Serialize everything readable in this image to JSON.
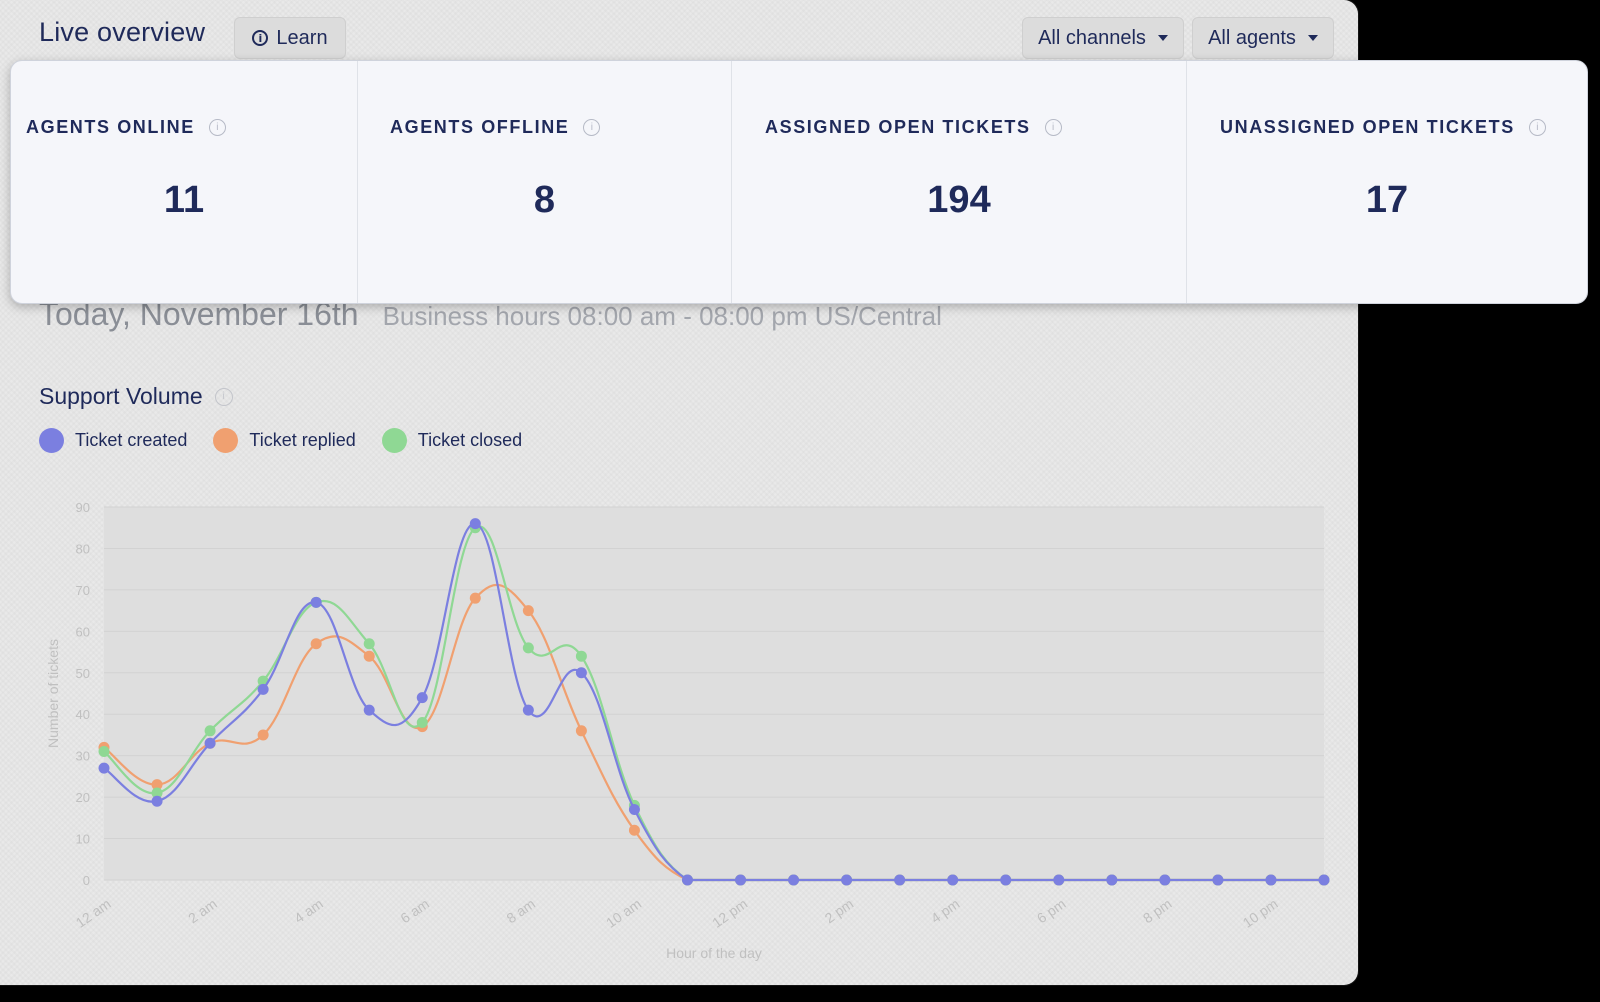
{
  "header": {
    "title": "Live overview",
    "learn_label": "Learn",
    "channels_label": "All channels",
    "agents_label": "All agents"
  },
  "stats": [
    {
      "label": "AGENTS ONLINE",
      "value": "11"
    },
    {
      "label": "AGENTS OFFLINE",
      "value": "8"
    },
    {
      "label": "ASSIGNED OPEN TICKETS",
      "value": "194"
    },
    {
      "label": "UNASSIGNED OPEN TICKETS",
      "value": "17"
    }
  ],
  "date_title": "Today, November 16th",
  "business_hours": "Business hours 08:00 am - 08:00 pm US/Central",
  "section_title": "Support Volume",
  "colors": {
    "created": "#7b7fe0",
    "replied": "#f0a070",
    "closed": "#8fd894",
    "primary_text": "#1f2a5a"
  },
  "chart_data": {
    "type": "line",
    "x": [
      "12 am",
      "1 am",
      "2 am",
      "3 am",
      "4 am",
      "5 am",
      "6 am",
      "7 am",
      "8 am",
      "9 am",
      "10 am",
      "11 am",
      "12 pm",
      "1 pm",
      "2 pm",
      "3 pm",
      "4 pm",
      "5 pm",
      "6 pm",
      "7 pm",
      "8 pm",
      "9 pm",
      "10 pm",
      "11 pm"
    ],
    "tick_labels": [
      "12 am",
      "2 am",
      "4 am",
      "6 am",
      "8 am",
      "10 am",
      "12 pm",
      "2 pm",
      "4 pm",
      "6 pm",
      "8 pm",
      "10 pm"
    ],
    "series": [
      {
        "name": "Ticket created",
        "color": "#7b7fe0",
        "values": [
          27,
          19,
          33,
          46,
          67,
          41,
          44,
          86,
          41,
          50,
          17,
          0,
          0,
          0,
          0,
          0,
          0,
          0,
          0,
          0,
          0,
          0,
          0,
          0
        ]
      },
      {
        "name": "Ticket replied",
        "color": "#f0a070",
        "values": [
          32,
          23,
          33,
          35,
          57,
          54,
          37,
          68,
          65,
          36,
          12,
          0,
          0,
          0,
          0,
          0,
          0,
          0,
          0,
          0,
          0,
          0,
          0,
          0
        ]
      },
      {
        "name": "Ticket closed",
        "color": "#8fd894",
        "values": [
          31,
          21,
          36,
          48,
          67,
          57,
          38,
          85,
          56,
          54,
          18,
          0,
          0,
          0,
          0,
          0,
          0,
          0,
          0,
          0,
          0,
          0,
          0,
          0
        ]
      }
    ],
    "yticks": [
      0,
      10,
      20,
      30,
      40,
      50,
      60,
      70,
      80,
      90
    ],
    "ylim": [
      0,
      90
    ],
    "xlabel": "Hour of the day",
    "ylabel": "Number of tickets",
    "legend": "top-left",
    "grid": true
  }
}
